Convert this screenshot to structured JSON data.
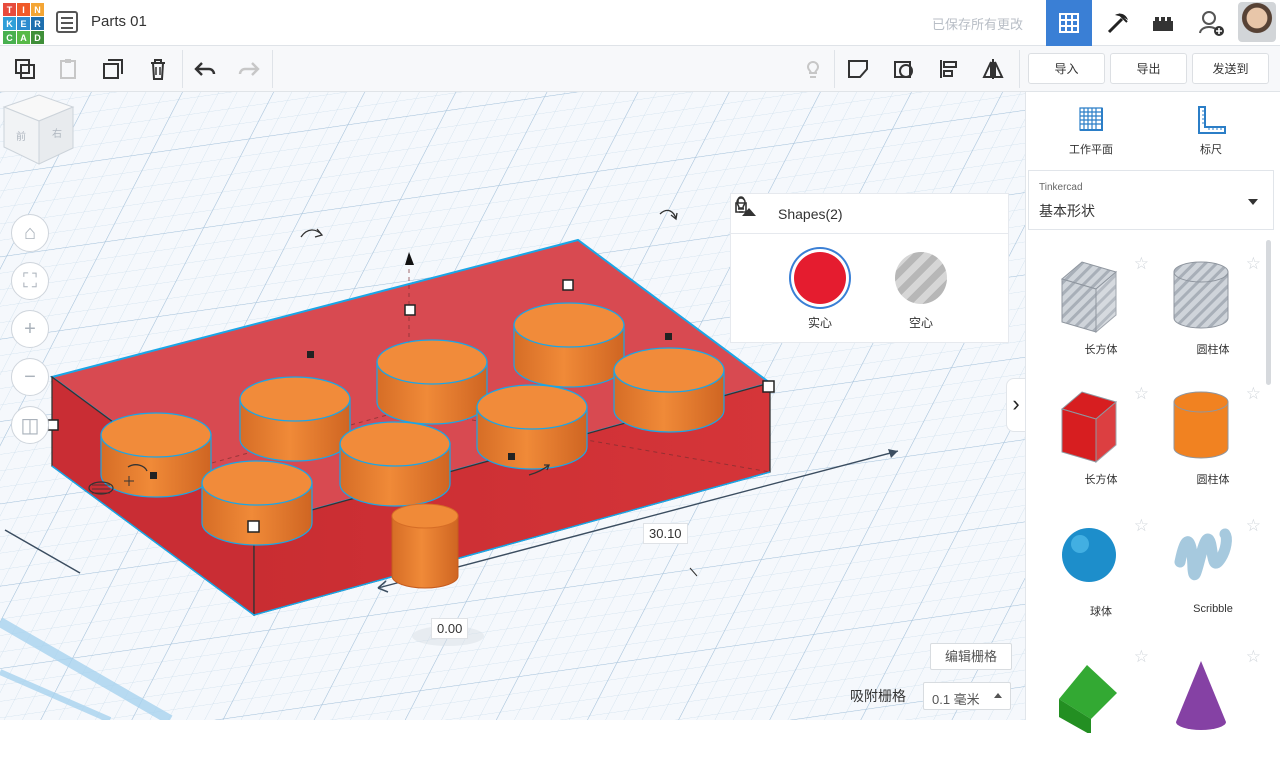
{
  "topbar": {
    "logo_letters": [
      "T",
      "I",
      "N",
      "K",
      "E",
      "R",
      "C",
      "A",
      "D"
    ],
    "logo_colors": [
      "#e74b3c",
      "#f05a28",
      "#f4a534",
      "#2f9fd8",
      "#2e8bcf",
      "#1f6fae",
      "#48b04f",
      "#57b947",
      "#3f8f39"
    ],
    "title": "Parts 01",
    "save_status": "已保存所有更改",
    "tabs": [
      "grid-icon",
      "pickaxe-icon",
      "brick-icon",
      "add-user-icon"
    ]
  },
  "toolbar": {
    "tools": [
      "copy-icon",
      "paste-icon",
      "duplicate-icon",
      "delete-icon",
      "undo-icon",
      "redo-icon",
      "bulb-icon",
      "group-icon",
      "ungroup-icon",
      "align-icon",
      "mirror-icon"
    ],
    "import_label": "导入",
    "export_label": "导出",
    "send_label": "发送到"
  },
  "viewport": {
    "viewcube_faces": [
      "前",
      "右"
    ],
    "nav_icons": [
      "home-icon",
      "fit-icon",
      "zoom-in-icon",
      "zoom-out-icon",
      "perspective-icon"
    ],
    "dimension_width": "30.10",
    "dimension_height": "0.00",
    "grid_edit_label": "编辑栅格",
    "snap_label": "吸附栅格",
    "snap_value": "0.1 毫米"
  },
  "shapes_panel": {
    "title": "Shapes(2)",
    "solid_label": "实心",
    "hole_label": "空心",
    "solid_color": "#e51c2f",
    "hole_color": "#b9b9b9"
  },
  "right_panel": {
    "workplane_label": "工作平面",
    "ruler_label": "标尺",
    "library_title": "Tinkercad",
    "library_selected": "基本形状",
    "shapes": [
      {
        "label": "长方体",
        "kind": "box-hole",
        "color": "#b8bcc2"
      },
      {
        "label": "圆柱体",
        "kind": "cylinder-hole",
        "color": "#b8bcc2"
      },
      {
        "label": "长方体",
        "kind": "box",
        "color": "#d71e20"
      },
      {
        "label": "圆柱体",
        "kind": "cylinder",
        "color": "#f18221"
      },
      {
        "label": "球体",
        "kind": "sphere",
        "color": "#1d8ecb"
      },
      {
        "label": "Scribble",
        "kind": "scribble",
        "color": "#a6c9de"
      },
      {
        "label": "",
        "kind": "roof",
        "color": "#33a933"
      },
      {
        "label": "",
        "kind": "cone",
        "color": "#8541a4"
      }
    ]
  },
  "colors": {
    "accent": "#3a7fd5",
    "red_base": "#d83b3f",
    "orange_stud": "#f18b3a",
    "grid": "#bcd2e5"
  }
}
